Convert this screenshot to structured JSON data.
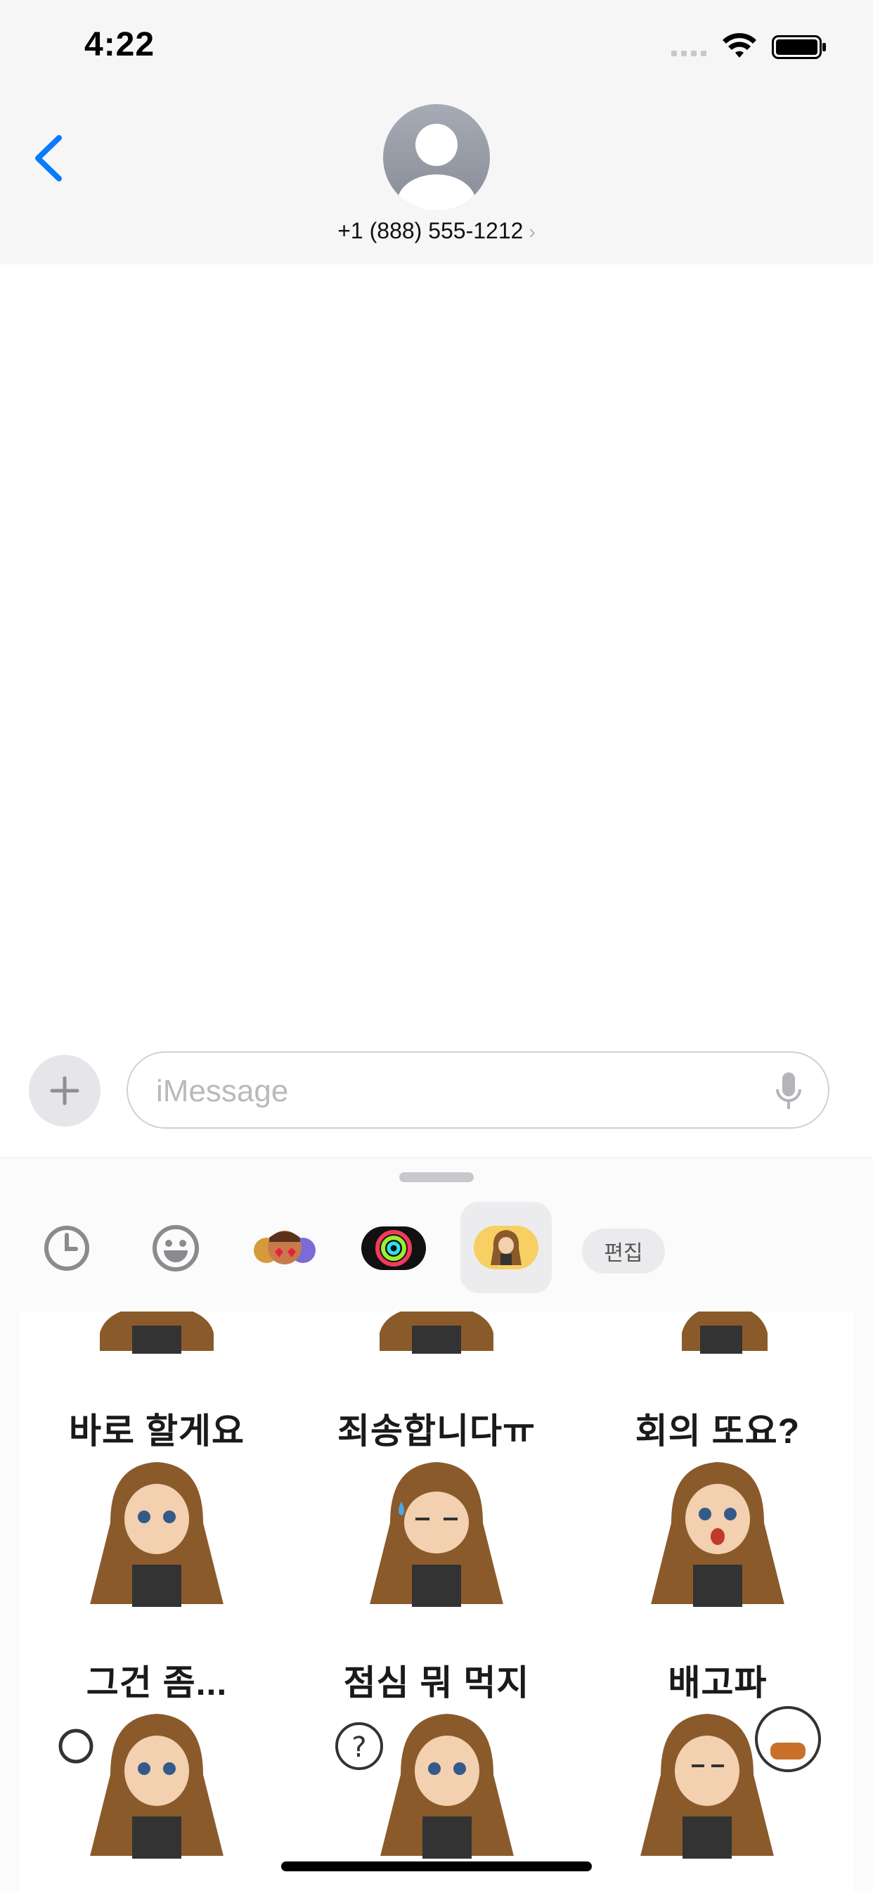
{
  "status": {
    "time": "4:22"
  },
  "nav": {
    "contact_number": "+1 (888) 555-1212"
  },
  "composer": {
    "placeholder": "iMessage"
  },
  "app_drawer": {
    "apps": [
      "recents-icon",
      "emoji-icon",
      "memoji-icon",
      "activity-icon",
      "sticker-pack-icon"
    ],
    "selected_app": "sticker-pack-icon",
    "edit_label": "편집"
  },
  "stickers": {
    "row1": [
      "",
      "",
      ""
    ],
    "row2": [
      "바로 할게요",
      "죄송합니다ㅠ",
      "회의 또요?"
    ],
    "row3": [
      "그건 좀...",
      "점심 뭐 먹지",
      "배고파"
    ]
  },
  "colors": {
    "accent": "#0a7aff",
    "hood_brown": "#8a5a2b",
    "activity_ring": "#f23b5a"
  }
}
